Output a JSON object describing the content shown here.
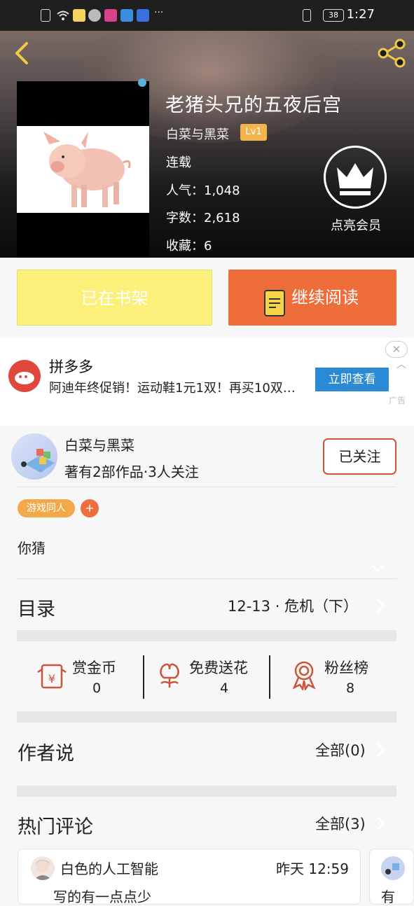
{
  "status_bar": {
    "time": "1:27",
    "battery": "38"
  },
  "book": {
    "title": "老猪头兄的五夜后宫",
    "author": "白菜与黑菜",
    "level": "Lv1",
    "status": "连载",
    "popularity": "人气：1,048",
    "word_count": "字数：2,618",
    "favorites": "收藏：6"
  },
  "vip": {
    "label": "点亮会员"
  },
  "actions": {
    "shelf_label": "已在书架",
    "read_label": "继续阅读"
  },
  "ad": {
    "name": "拼多多",
    "text": "阿迪年终促销！运动鞋1元1双！再买10双…",
    "button": "立即查看",
    "close": "✕",
    "tag": "广告"
  },
  "author_block": {
    "name": "白菜与黑菜",
    "stats": "著有2部作品·3人关注",
    "follow_label": "已关注"
  },
  "tags": {
    "genre": "游戏同人",
    "add": "+"
  },
  "intro": "你猜",
  "catalog": {
    "title": "目录",
    "latest": "12-13 · 危机（下）"
  },
  "rewards": [
    {
      "label": "赏金币",
      "value": "0"
    },
    {
      "label": "免费送花",
      "value": "4"
    },
    {
      "label": "粉丝榜",
      "value": "8"
    }
  ],
  "author_says": {
    "title": "作者说",
    "all": "全部(0)"
  },
  "hot_comments": {
    "title": "热门评论",
    "all": "全部(3)",
    "first": {
      "user": "白色的人工智能",
      "time": "昨天 12:59",
      "text": "写的有一点点少"
    },
    "second_text": "有"
  },
  "colors": {
    "accent": "#ee6d3b",
    "shelf": "#fbf07a",
    "tag": "#f3a94a",
    "ad_button": "#2b8ad6"
  }
}
